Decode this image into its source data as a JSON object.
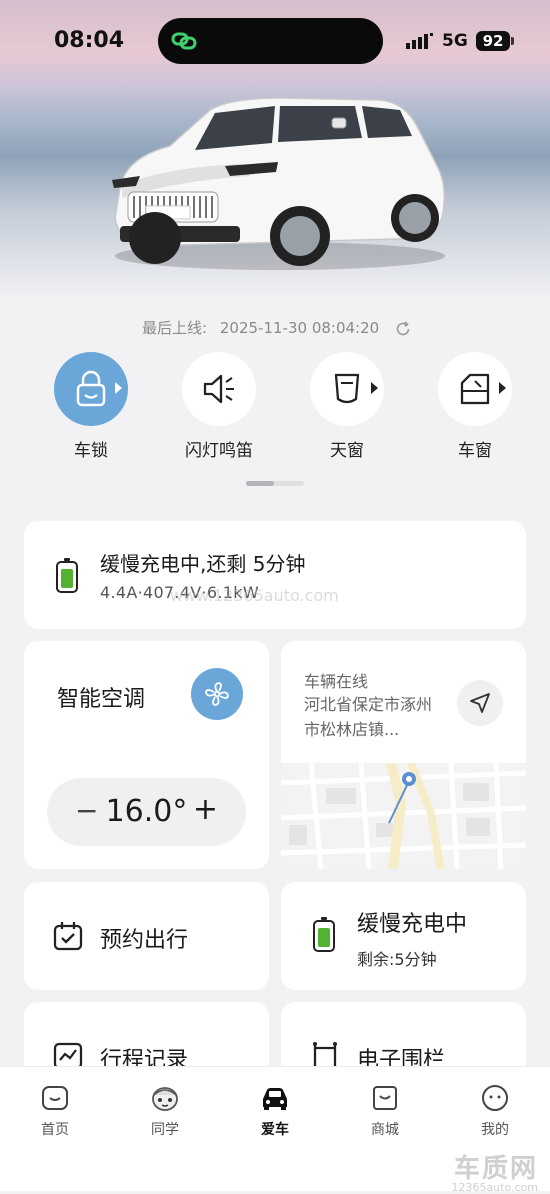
{
  "status_bar": {
    "time": "08:04",
    "network": "5G",
    "battery": "92"
  },
  "last_online": {
    "label": "最后上线:",
    "value": "2025-11-30 08:04:20"
  },
  "quick_actions": [
    {
      "label": "车锁",
      "icon": "lock-icon",
      "active": true
    },
    {
      "label": "闪灯鸣笛",
      "icon": "horn-icon",
      "active": false
    },
    {
      "label": "天窗",
      "icon": "sunroof-icon",
      "active": false
    },
    {
      "label": "车窗",
      "icon": "window-icon",
      "active": false
    }
  ],
  "charging": {
    "title": "缓慢充电中,还剩 5分钟",
    "detail": "4.4A·407.4V·6.1kW",
    "battery_color": "#53b232"
  },
  "climate": {
    "title": "智能空调",
    "minus": "−",
    "temperature": "16.0°",
    "plus": "+"
  },
  "location": {
    "status": "车辆在线",
    "address": "河北省保定市涿州市松林店镇..."
  },
  "tiles": {
    "booking": "预约出行",
    "charge_status": "缓慢充电中",
    "charge_remaining": "剩余:5分钟",
    "trip": "行程记录",
    "fence": "电子围栏"
  },
  "tabs": [
    {
      "label": "首页",
      "icon": "home-icon"
    },
    {
      "label": "同学",
      "icon": "classmate-icon"
    },
    {
      "label": "爱车",
      "icon": "car-icon",
      "active": true
    },
    {
      "label": "商城",
      "icon": "shop-icon"
    },
    {
      "label": "我的",
      "icon": "profile-icon"
    }
  ],
  "watermark": {
    "main": "车质网",
    "sub": "12365auto.com",
    "center": "www.12365auto.com"
  },
  "colors": {
    "accent": "#6aa6d7",
    "background": "#f2f2f5",
    "charge_green": "#53b232"
  }
}
